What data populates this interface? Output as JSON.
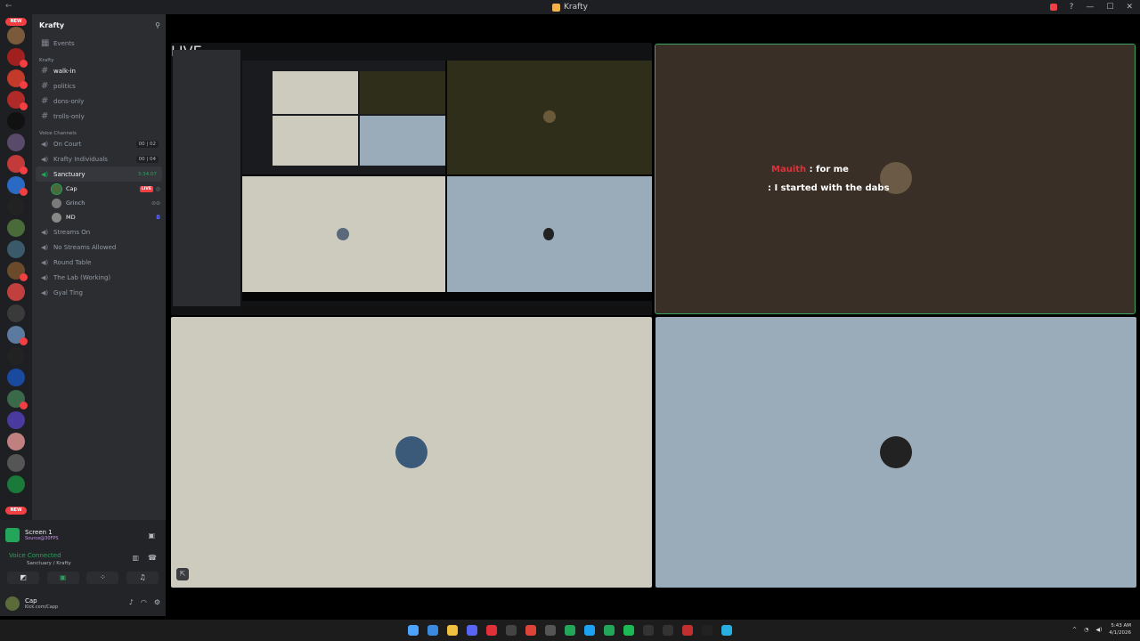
{
  "window": {
    "title": "Krafty"
  },
  "colors": {
    "discord_bg": "#2b2d31",
    "rail_bg": "#1e1f22",
    "green": "#23a55a",
    "red": "#f23f43",
    "tile_beige": "#cdcbbe",
    "tile_blue": "#9aabba",
    "tile_brown": "#3a2f26",
    "tile_olive": "#2e2e1a"
  },
  "rail": {
    "new_label_top": "NEW",
    "new_label_bottom": "NEW"
  },
  "sidebar": {
    "server_name": "Krafty",
    "events_label": "Events",
    "category_krafty": "Krafty",
    "text_channels": [
      {
        "name": "walk-in",
        "state": "unread"
      },
      {
        "name": "politics",
        "state": "normal"
      },
      {
        "name": "dons-only",
        "state": "normal"
      },
      {
        "name": "trolls-only",
        "state": "normal"
      }
    ],
    "category_voice": "Voice Channels",
    "voice_channels_top": [
      {
        "name": "On Court",
        "count": "00 | 02"
      },
      {
        "name": "Krafty Individuals",
        "count": "00 | 04"
      }
    ],
    "active_voice": {
      "name": "Sanctuary",
      "time": "3:34:07"
    },
    "voice_users": [
      {
        "name": "Cap",
        "live": "LIVE"
      },
      {
        "name": "Grinch",
        "live": ""
      },
      {
        "name": "MD",
        "live": ""
      }
    ],
    "voice_channels_bottom": [
      {
        "name": "Streams On"
      },
      {
        "name": "No Streams Allowed"
      },
      {
        "name": "Round Table"
      },
      {
        "name": "The Lab (Working)"
      },
      {
        "name": "Gyal Ting"
      }
    ]
  },
  "bottom": {
    "stream_title": "Screen 1",
    "stream_sub": "Source@30FPS",
    "voice_status": "Voice Connected",
    "voice_location": "Sanctuary / Krafty",
    "user_name": "Cap",
    "user_status": "Kick.com/Capp"
  },
  "stage": {
    "mini_live": "LIVE",
    "chat_name": "Mauith",
    "chat_line1": ": for me",
    "chat_line2": ": I started with the dabs"
  },
  "tray": {
    "time": "5:43 AM",
    "date": "4/1/2026"
  }
}
